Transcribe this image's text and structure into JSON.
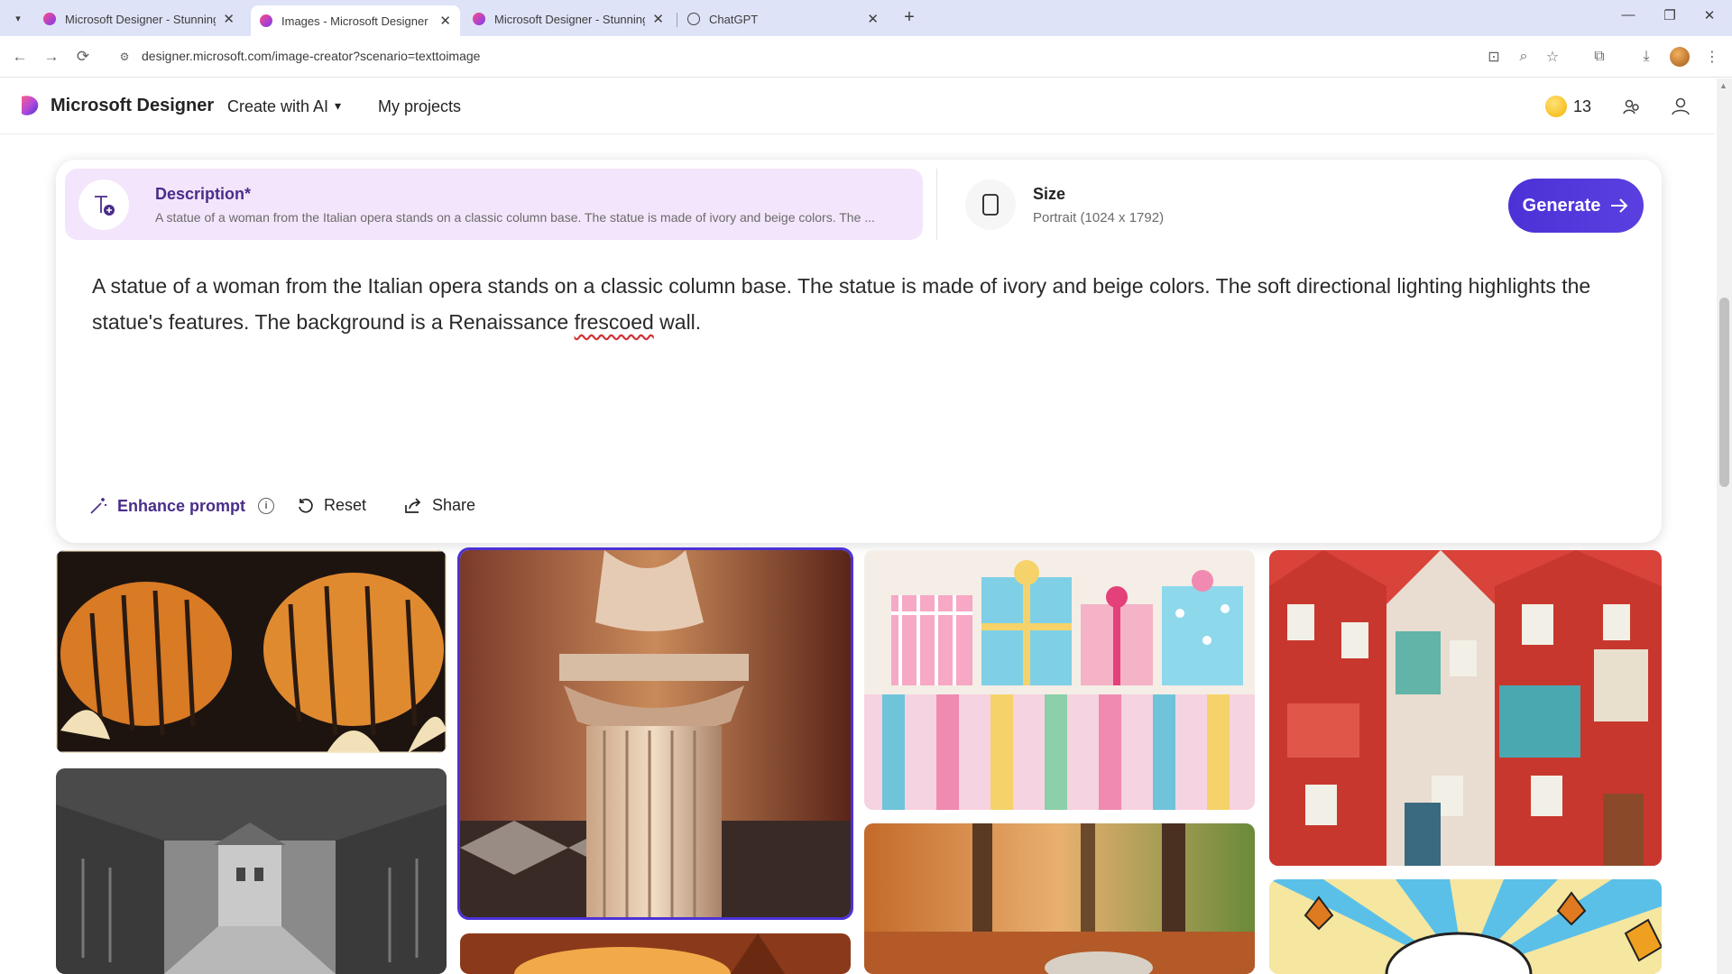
{
  "browser": {
    "tabs": [
      {
        "title": "Microsoft Designer - Stunning",
        "active": false
      },
      {
        "title": "Images - Microsoft Designer",
        "active": true
      },
      {
        "title": "Microsoft Designer - Stunning",
        "active": false
      },
      {
        "title": "ChatGPT",
        "active": false
      }
    ],
    "url": "designer.microsoft.com/image-creator?scenario=texttoimage"
  },
  "header": {
    "brand": "Microsoft Designer",
    "nav": [
      "Create with AI",
      "My projects"
    ],
    "coins": "13"
  },
  "prompt_card": {
    "description_label": "Description*",
    "description_preview": "A statue of a woman from the Italian opera stands on a classic column base. The statue is made of ivory and beige colors. The ...",
    "size_label": "Size",
    "size_value": "Portrait (1024 x 1792)",
    "generate_label": "Generate",
    "prompt_before": "A statue of a woman from the Italian opera stands on a classic column base. The statue is made of ivory and beige colors. The soft directional lighting highlights the statue's features. The background is a Renaissance ",
    "prompt_typo": "frescoed",
    "prompt_after": " wall.",
    "actions": {
      "enhance": "Enhance prompt",
      "reset": "Reset",
      "share": "Share"
    }
  },
  "gallery": {
    "tiles": [
      {
        "subject": "pumpkins"
      },
      {
        "subject": "statue-column",
        "selected": true
      },
      {
        "subject": "gift-boxes"
      },
      {
        "subject": "patchwork-houses"
      },
      {
        "subject": "rainy-street"
      },
      {
        "subject": "autumn-forest"
      },
      {
        "subject": "comic-autumn"
      },
      {
        "subject": "warm-scene"
      }
    ]
  },
  "colors": {
    "accent": "#4b32d6",
    "description_bg": "#f3e5fb",
    "coin": "#f5b300"
  }
}
